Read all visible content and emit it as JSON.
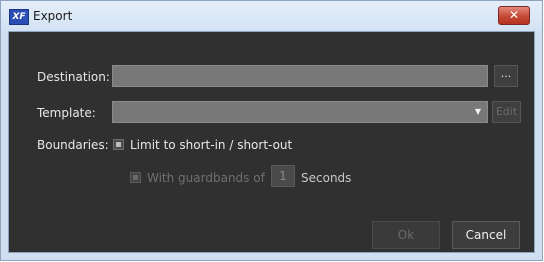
{
  "window": {
    "title": "Export",
    "icon_text": "XF",
    "close_icon": "close-x-icon",
    "close_glyph": "✕"
  },
  "destination": {
    "label": "Destination:",
    "value": "",
    "browse_label": "..."
  },
  "template": {
    "label": "Template:",
    "value": "",
    "dropdown_glyph": "▼",
    "edit_label": "Edit"
  },
  "boundaries": {
    "label": "Boundaries:",
    "limit_checkbox_label": "Limit to short-in / short-out",
    "guardbands_label": "With guardbands of",
    "guardbands_value": "1",
    "seconds_label": "Seconds"
  },
  "buttons": {
    "ok": "Ok",
    "cancel": "Cancel"
  },
  "colors": {
    "dialog_bg": "#303030",
    "field_bg": "#787878",
    "close_red": "#c44a36"
  }
}
